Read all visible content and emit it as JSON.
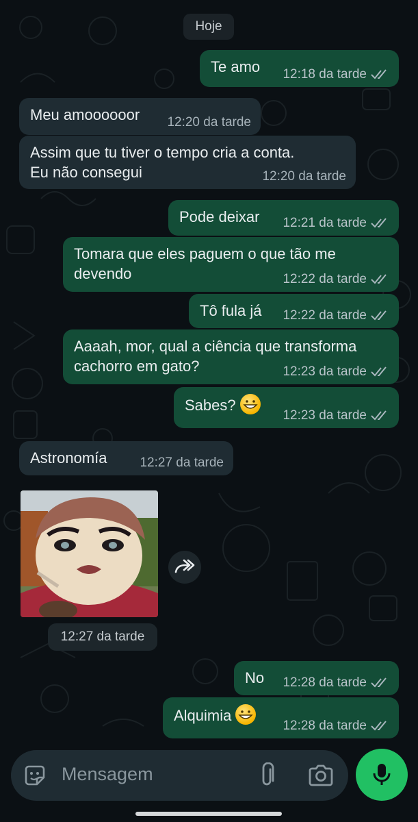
{
  "date_chip": "Hoje",
  "messages": [
    {
      "dir": "out",
      "text": "Te amo",
      "time": "12:18 da tarde"
    },
    {
      "dir": "in",
      "text": "Meu amoooooor",
      "time": "12:20 da tarde"
    },
    {
      "dir": "in",
      "text": "Assim que tu tiver o tempo cria a conta.\nEu não consegui",
      "time": "12:20 da tarde"
    },
    {
      "dir": "out",
      "text": "Pode deixar",
      "time": "12:21 da tarde"
    },
    {
      "dir": "out",
      "text": "Tomara que eles paguem o que tão me\ndevendo",
      "time": "12:22 da tarde"
    },
    {
      "dir": "out",
      "text": "Tô fula já",
      "time": "12:22 da tarde"
    },
    {
      "dir": "out",
      "text": "Aaaah, mor, qual a ciência que transforma\ncachorro em gato?",
      "time": "12:23 da tarde"
    },
    {
      "dir": "out",
      "text": "Sabes?",
      "time": "12:23 da tarde",
      "emoji": "grinning-face"
    },
    {
      "dir": "in",
      "text": "Astronomía",
      "time": "12:27 da tarde"
    },
    {
      "dir": "out",
      "text": "No",
      "time": "12:28 da tarde"
    },
    {
      "dir": "out",
      "text": "Alquimia",
      "time": "12:28 da tarde",
      "emoji": "grinning-face"
    }
  ],
  "image_message": {
    "time": "12:27 da tarde",
    "content": "cartoon-portrait",
    "forward_icon": "forward-icon"
  },
  "composer": {
    "placeholder": "Mensagem",
    "icons": [
      "sticker-icon",
      "attach-icon",
      "camera-icon",
      "mic-icon"
    ]
  },
  "colors": {
    "background": "#0b1014",
    "outgoing": "#134d37",
    "incoming": "#1f2c33",
    "mic": "#21c063"
  }
}
